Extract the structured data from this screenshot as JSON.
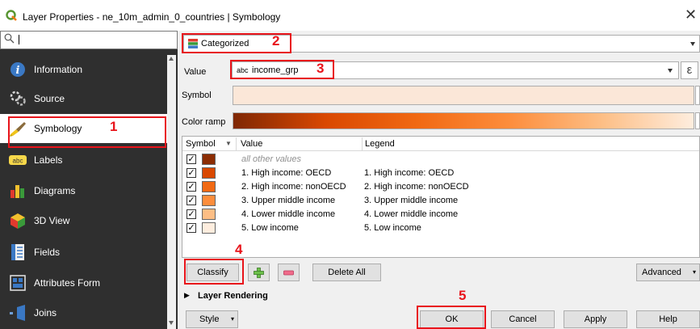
{
  "window": {
    "title": "Layer Properties - ne_10m_admin_0_countries | Symbology",
    "close_glyph": "✕"
  },
  "sidebar": {
    "search_placeholder": "",
    "items": [
      {
        "label": "Information",
        "icon": "info-icon"
      },
      {
        "label": "Source",
        "icon": "source-icon"
      },
      {
        "label": "Symbology",
        "icon": "paintbrush-icon",
        "active": true
      },
      {
        "label": "Labels",
        "icon": "labels-icon"
      },
      {
        "label": "Diagrams",
        "icon": "diagrams-icon"
      },
      {
        "label": "3D View",
        "icon": "3d-cube-icon"
      },
      {
        "label": "Fields",
        "icon": "fields-icon"
      },
      {
        "label": "Attributes Form",
        "icon": "attributes-form-icon"
      },
      {
        "label": "Joins",
        "icon": "joins-icon"
      }
    ]
  },
  "renderer": {
    "value": "Categorized"
  },
  "value_field": {
    "label": "Value",
    "type_prefix": "abc",
    "value": "income_grp",
    "expr_glyph": "ε"
  },
  "symbol_row": {
    "label": "Symbol"
  },
  "color_ramp_row": {
    "label": "Color ramp"
  },
  "table": {
    "columns": [
      "Symbol",
      "Value",
      "Legend"
    ],
    "rows": [
      {
        "value": "all other values",
        "legend": "",
        "color": "#8c2d04",
        "checked": true
      },
      {
        "value": "1. High income: OECD",
        "legend": "1. High income: OECD",
        "color": "#d94801",
        "checked": true
      },
      {
        "value": "2. High income: nonOECD",
        "legend": "2. High income: nonOECD",
        "color": "#f16913",
        "checked": true
      },
      {
        "value": "3. Upper middle income",
        "legend": "3. Upper middle income",
        "color": "#fd8d3c",
        "checked": true
      },
      {
        "value": "4. Lower middle income",
        "legend": "4. Lower middle income",
        "color": "#fdbe85",
        "checked": true
      },
      {
        "value": "5. Low income",
        "legend": "5. Low income",
        "color": "#feedde",
        "checked": true
      }
    ]
  },
  "buttons": {
    "classify": "Classify",
    "delete_all": "Delete All",
    "advanced": "Advanced",
    "style": "Style",
    "ok": "OK",
    "cancel": "Cancel",
    "apply": "Apply",
    "help": "Help"
  },
  "layer_rendering": {
    "label": "Layer Rendering"
  },
  "annotations": [
    "1",
    "2",
    "3",
    "4",
    "5"
  ],
  "colors": {
    "highlight": "#e8141b",
    "sidebar_bg": "#2f2f2f",
    "panel_bg": "#f0f0f0"
  }
}
